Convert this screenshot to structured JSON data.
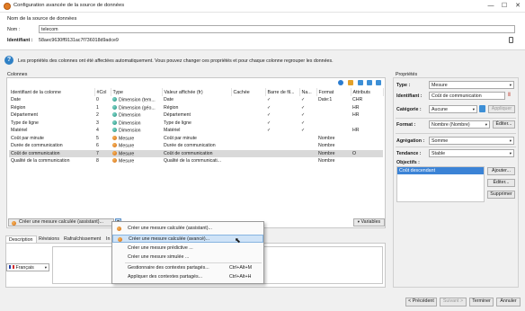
{
  "window": {
    "title": "Configuration avancée de la source de données",
    "minimize_icon": "minimize-icon",
    "maximize_icon": "maximize-icon",
    "close_icon": "close-icon"
  },
  "header": {
    "section_title": "Nom de la source de données",
    "name_label": "Nom :",
    "name_value": "telecom",
    "id_label": "Identifiant :",
    "id_value": "58aec9630ff9131ac7f736018d9adce9"
  },
  "info_message": "Les propriétés des colonnes ont été affectées automatiquement. Vous pouvez changer ces propriétés et pour chaque colonne regrouper les données.",
  "columns_panel": {
    "title": "Colonnes",
    "headers": [
      "Identifiant de la colonne",
      "#Col",
      "Type",
      "Valeur affichée (fr)",
      "Cachée",
      "Barre de fil...",
      "Na...",
      "Format",
      "Attributs"
    ],
    "rows": [
      {
        "id": "Date",
        "col": "0",
        "type": "Dimension (tem...",
        "kind": "dim",
        "display": "Date",
        "hidden": "",
        "filter": "✓",
        "na": "✓",
        "format": "Date:1",
        "attr": "CHR"
      },
      {
        "id": "Région",
        "col": "1",
        "type": "Dimension (géo...",
        "kind": "dim",
        "display": "Région",
        "hidden": "",
        "filter": "✓",
        "na": "✓",
        "format": "",
        "attr": "HR"
      },
      {
        "id": "Département",
        "col": "2",
        "type": "Dimension",
        "kind": "dim",
        "display": "Département",
        "hidden": "",
        "filter": "✓",
        "na": "✓",
        "format": "",
        "attr": "HR"
      },
      {
        "id": "Type de ligne",
        "col": "3",
        "type": "Dimension",
        "kind": "dim",
        "display": "Type de ligne",
        "hidden": "",
        "filter": "✓",
        "na": "✓",
        "format": "",
        "attr": ""
      },
      {
        "id": "Matériel",
        "col": "4",
        "type": "Dimension",
        "kind": "dim",
        "display": "Matériel",
        "hidden": "",
        "filter": "✓",
        "na": "✓",
        "format": "",
        "attr": "HR"
      },
      {
        "id": "Coût par minute",
        "col": "5",
        "type": "Mesure",
        "kind": "mes",
        "display": "Coût par minute",
        "hidden": "",
        "filter": "",
        "na": "",
        "format": "Nombre",
        "attr": ""
      },
      {
        "id": "Durée de communication",
        "col": "6",
        "type": "Mesure",
        "kind": "mes",
        "display": "Durée de communication",
        "hidden": "",
        "filter": "",
        "na": "",
        "format": "Nombre",
        "attr": ""
      },
      {
        "id": "Coût de communication",
        "col": "7",
        "type": "Mesure",
        "kind": "mes",
        "display": "Coût de communication",
        "hidden": "",
        "filter": "",
        "na": "",
        "format": "Nombre",
        "attr": "O"
      },
      {
        "id": "Qualité de la communication",
        "col": "8",
        "type": "Mesure",
        "kind": "mes",
        "display": "Qualité de la communicati...",
        "hidden": "",
        "filter": "",
        "na": "",
        "format": "Nombre",
        "attr": ""
      }
    ],
    "create_button": "Créer une mesure calculée (assistant)...",
    "variables_button": "Variables"
  },
  "context_menu": {
    "items": [
      {
        "label": "Créer une mesure calculée (assistant)...",
        "shortcut": "",
        "icon": "measure-icon"
      },
      {
        "label": "Créer une mesure calculée (avancé)...",
        "shortcut": "",
        "icon": "measure-icon"
      },
      {
        "label": "Créer une mesure prédictive ...",
        "shortcut": "",
        "icon": ""
      },
      {
        "label": "Créer une mesure simulée ...",
        "shortcut": "",
        "icon": ""
      },
      {
        "label": "Gestionnaire des contextes partagés...",
        "shortcut": "Ctrl+Alt+M",
        "icon": ""
      },
      {
        "label": "Appliquer des contextes partagés...",
        "shortcut": "Ctrl+Alt+H",
        "icon": ""
      }
    ]
  },
  "bottom_tabs": [
    "Description",
    "Révisions",
    "Rafraîchissement",
    "In"
  ],
  "language": "Français",
  "properties": {
    "title": "Propriétés",
    "type_label": "Type :",
    "type_value": "Mesure",
    "id_label": "Identifiant :",
    "id_value": "Coût de communication",
    "category_label": "Catégorie :",
    "category_value": "Aucune",
    "apply_button": "Appliquer",
    "format_label": "Format :",
    "format_value": "Nombre (Nombre)",
    "edit_button": "Éditer...",
    "aggregation_label": "Agrégation :",
    "aggregation_value": "Somme",
    "trend_label": "Tendance :",
    "trend_value": "Stable",
    "objectives_label": "Objectifs :",
    "objective_item": "Coût descendant",
    "add_button": "Ajouter...",
    "edit2_button": "Éditer...",
    "delete_button": "Supprimer"
  },
  "footer": {
    "prev": "< Précédent",
    "next": "Suivant >",
    "finish": "Terminer",
    "cancel": "Annuler"
  }
}
